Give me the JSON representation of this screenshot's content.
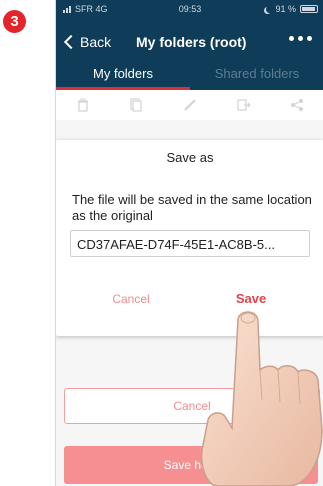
{
  "step_number": "3",
  "status_bar": {
    "carrier": "SFR 4G",
    "time": "09:53",
    "battery": "91 %"
  },
  "nav": {
    "back_label": "Back",
    "title": "My folders (root)"
  },
  "tabs": [
    {
      "label": "My folders"
    },
    {
      "label": "Shared folders"
    }
  ],
  "toolbar": {
    "icons": [
      "trash-icon",
      "copy-icon",
      "pencil-icon",
      "move-icon",
      "share-icon"
    ]
  },
  "dialog": {
    "title": "Save as",
    "message": "The file will be saved in the same location as the original",
    "filename": "CD37AFAE-D74F-45E1-AC8B-5...",
    "cancel_label": "Cancel",
    "save_label": "Save"
  },
  "bottom": {
    "cancel_label": "Cancel",
    "save_here_label": "Save here"
  },
  "colors": {
    "header": "#0f3c58",
    "accent": "#e3242b",
    "save_here": "#f58f92"
  }
}
